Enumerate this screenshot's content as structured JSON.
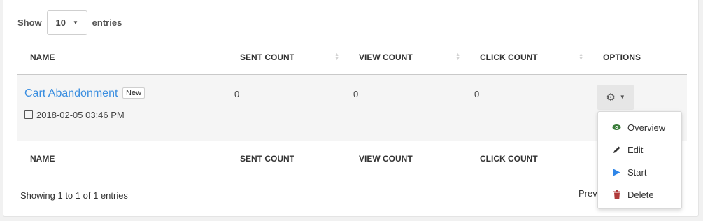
{
  "length_menu": {
    "show_label": "Show",
    "selected": "10",
    "entries_label": "entries"
  },
  "table": {
    "columns": [
      "NAME",
      "SENT COUNT",
      "VIEW COUNT",
      "CLICK COUNT",
      "OPTIONS"
    ],
    "rows": [
      {
        "name": "Cart Abandonment",
        "badge": "New",
        "date": "2018-02-05 03:46 PM",
        "sent_count": "0",
        "view_count": "0",
        "click_count": "0"
      }
    ]
  },
  "options_menu": {
    "items": [
      {
        "label": "Overview",
        "icon": "eye-icon",
        "color": "#3a7d3a"
      },
      {
        "label": "Edit",
        "icon": "pencil-icon",
        "color": "#333333"
      },
      {
        "label": "Start",
        "icon": "play-icon",
        "color": "#2f86e8"
      },
      {
        "label": "Delete",
        "icon": "trash-icon",
        "color": "#b03a3a"
      }
    ]
  },
  "footer": {
    "info": "Showing 1 to 1 of 1 entries",
    "paginate_prev": "Previ"
  },
  "colors": {
    "link": "#3a8ee0",
    "row_background": "#f5f5f5"
  }
}
